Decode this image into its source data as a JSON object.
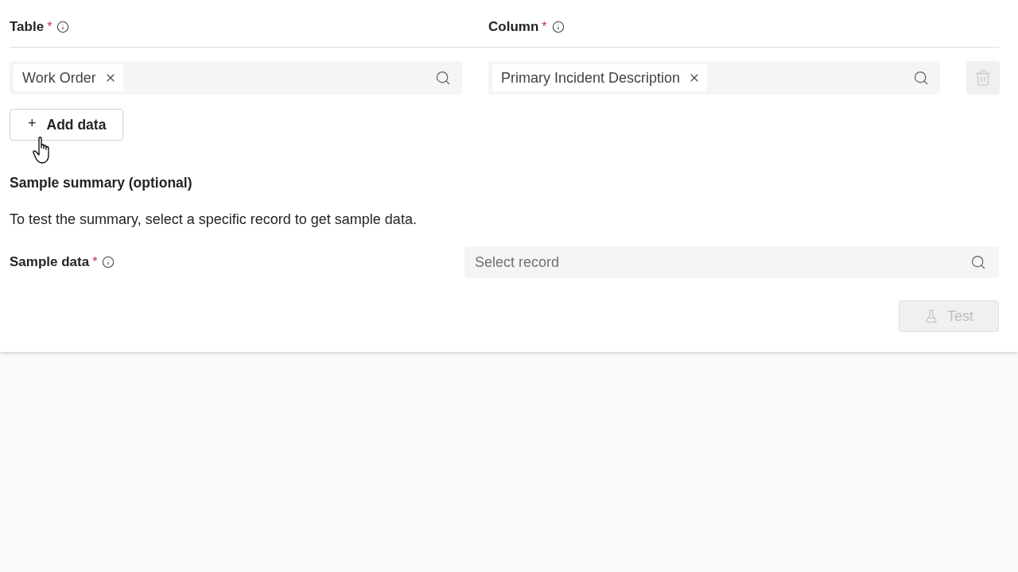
{
  "data_header": {
    "columns": [
      {
        "label": "Table",
        "required_mark": "*"
      },
      {
        "label": "Column",
        "required_mark": "*"
      }
    ]
  },
  "data_rows": [
    {
      "table_chip": "Work Order",
      "column_chip": "Primary Incident Description",
      "disabled": true
    }
  ],
  "add_button": {
    "label": "+",
    "text": "Add data"
  },
  "sample_summary": {
    "title": "Sample summary (optional)",
    "description": "To test the summary, select a specific record to get sample data.",
    "sample_data": {
      "label": "Sample data",
      "required_mark": "*",
      "placeholder": "Select record"
    }
  },
  "test_button": {
    "label": "Test",
    "disabled": true
  }
}
